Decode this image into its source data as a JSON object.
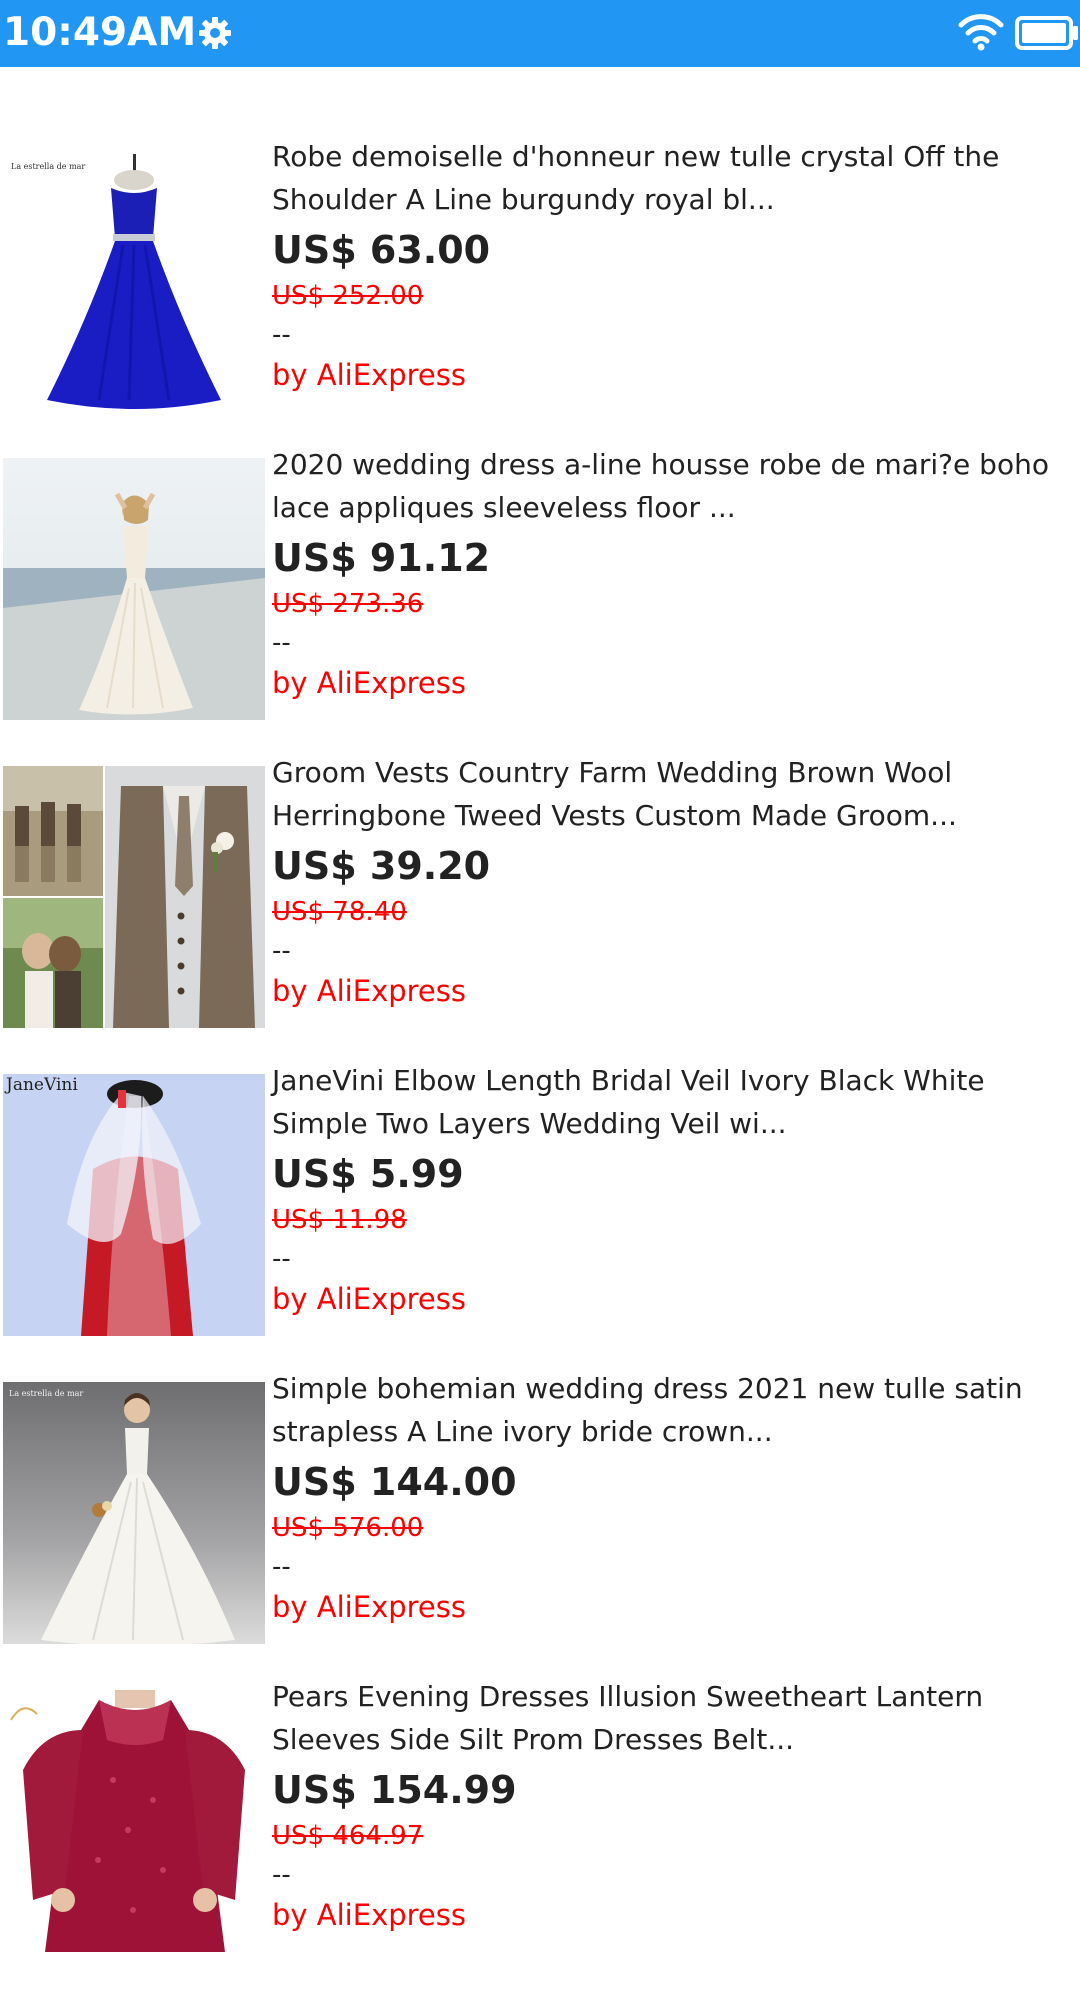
{
  "status_bar": {
    "time": "10:49AM",
    "icons": [
      "gear-icon",
      "wifi-icon",
      "battery-icon"
    ],
    "color": "#2196f3"
  },
  "products": [
    {
      "title": "Robe demoiselle d'honneur new tulle crystal Off the Shoulder A Line burgundy royal bl...",
      "price": "US$ 63.00",
      "original_price": "US$ 252.00",
      "rating": "--",
      "seller": "by AliExpress",
      "image_brand": "La estrella de mar"
    },
    {
      "title": "2020 wedding dress a-line housse robe de mari?e boho lace appliques sleeveless floor ...",
      "price": "US$ 91.12",
      "original_price": "US$ 273.36",
      "rating": "--",
      "seller": "by AliExpress"
    },
    {
      "title": "Groom Vests Country Farm Wedding Brown Wool Herringbone Tweed Vests Custom Made Groom...",
      "price": "US$ 39.20",
      "original_price": "US$ 78.40",
      "rating": "--",
      "seller": "by AliExpress"
    },
    {
      "title": "JaneVini Elbow Length Bridal Veil Ivory Black White Simple Two Layers Wedding Veil wi...",
      "price": "US$ 5.99",
      "original_price": "US$ 11.98",
      "rating": "--",
      "seller": "by AliExpress",
      "image_brand": "JaneVini"
    },
    {
      "title": "Simple bohemian wedding dress 2021 new tulle satin strapless A Line ivory bride crown...",
      "price": "US$ 144.00",
      "original_price": "US$ 576.00",
      "rating": "--",
      "seller": "by AliExpress",
      "image_brand": "La estrella de mar"
    },
    {
      "title": "Pears Evening Dresses Illusion Sweetheart Lantern Sleeves Side Silt Prom Dresses Belt...",
      "price": "US$ 154.99",
      "original_price": "US$ 464.97",
      "rating": "--",
      "seller": "by AliExpress"
    }
  ],
  "colors": {
    "accent_red": "#ff0000",
    "text": "#222222"
  }
}
